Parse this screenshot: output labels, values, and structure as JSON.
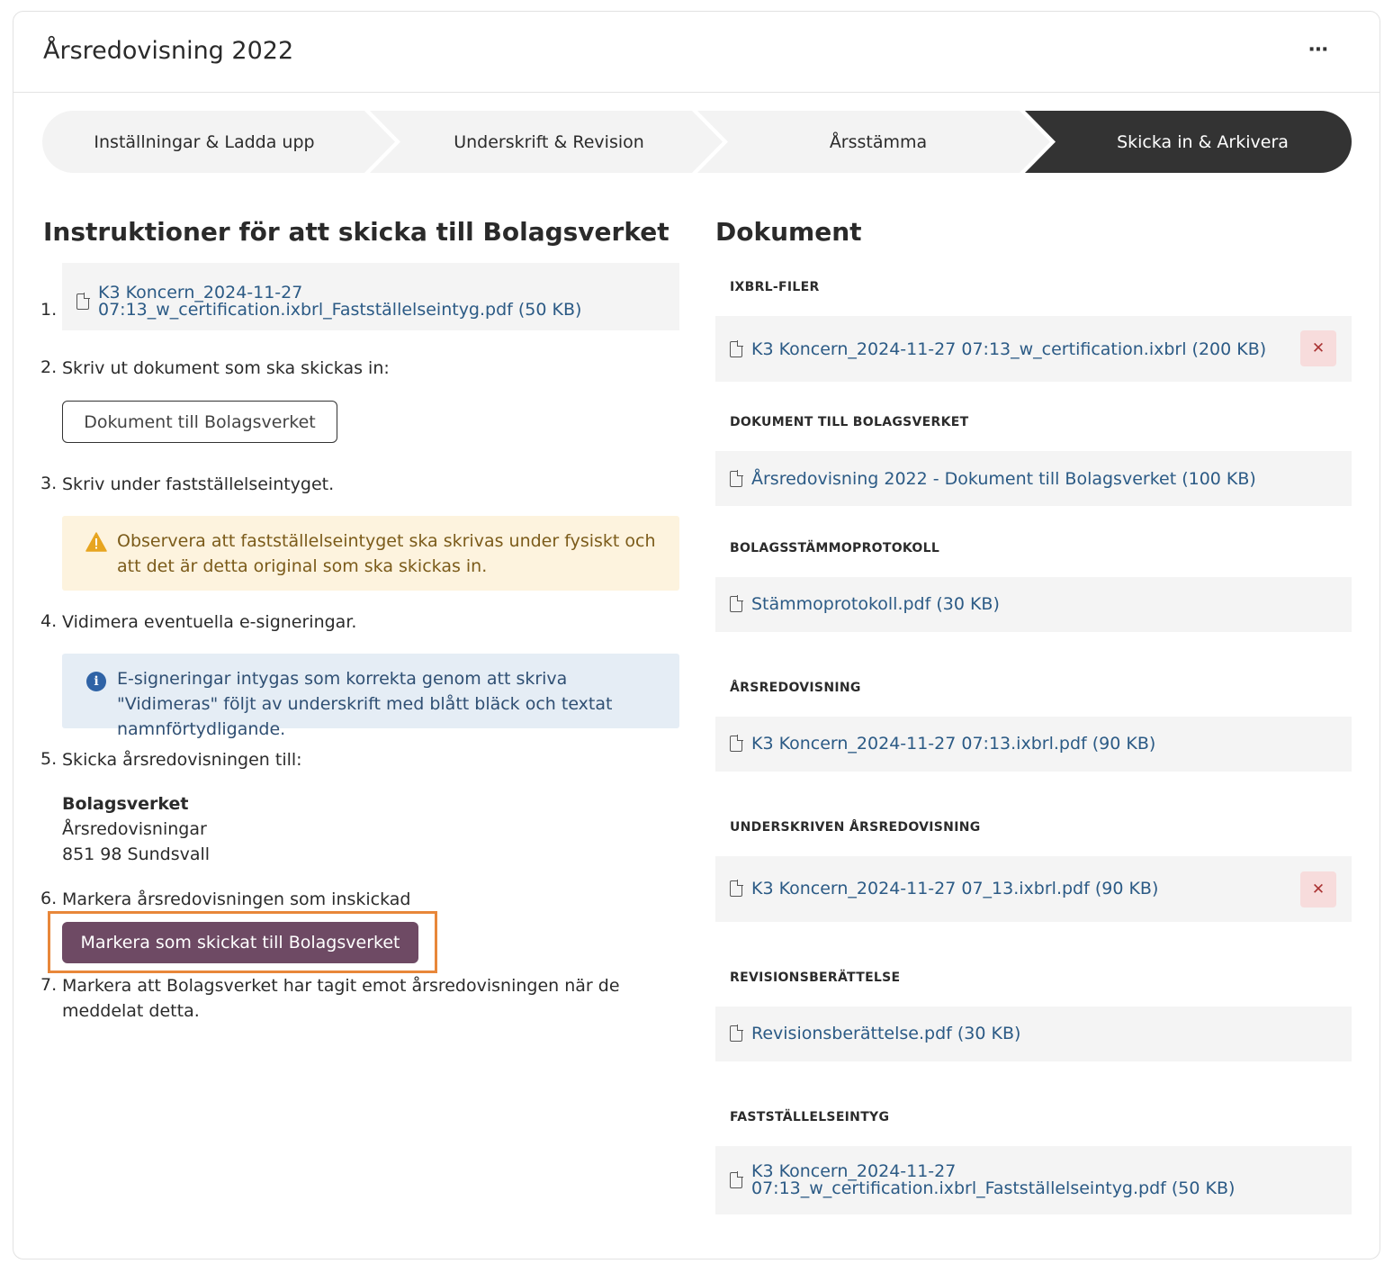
{
  "header": {
    "title": "Årsredovisning 2022",
    "more_label": "⋯"
  },
  "stepper": [
    {
      "label": "Inställningar & Ladda upp",
      "active": false
    },
    {
      "label": "Underskrift & Revision",
      "active": false
    },
    {
      "label": "Årsstämma",
      "active": false
    },
    {
      "label": "Skicka in & Arkivera",
      "active": true
    }
  ],
  "instructions": {
    "title": "Instruktioner för att skicka till Bolagsverket",
    "steps": [
      {
        "num": "1.",
        "file_line1": "K3 Koncern_2024-11-27",
        "file_line2": "07:13_w_certification.ixbrl_Fastställelseintyg.pdf (50 KB)"
      },
      {
        "num": "2.",
        "text": "Skriv ut dokument som ska skickas in:",
        "button": "Dokument till Bolagsverket"
      },
      {
        "num": "3.",
        "text": "Skriv under fastställelseintyget.",
        "warning": "Observera att fastställelseintyget ska skrivas under fysiskt och att det är detta original som ska skickas in."
      },
      {
        "num": "4.",
        "text": "Vidimera eventuella e-signeringar.",
        "info": "E-signeringar intygas som korrekta genom att skriva \"Vidimeras\" följt av underskrift med blått bläck och textat namnförtydligande."
      },
      {
        "num": "5.",
        "text": "Skicka årsredovisningen till:",
        "address": {
          "name": "Bolagsverket",
          "line1": "Årsredovisningar",
          "line2": "851 98 Sundsvall"
        }
      },
      {
        "num": "6.",
        "text": "Markera årsredovisningen som inskickad",
        "button": "Markera som skickat till Bolagsverket"
      },
      {
        "num": "7.",
        "text": "Markera att Bolagsverket har tagit emot årsredovisningen när de meddelat detta."
      }
    ]
  },
  "documents": {
    "title": "Dokument",
    "sections": [
      {
        "label": "IXBRL-FILER",
        "file": "K3 Koncern_2024-11-27 07:13_w_certification.ixbrl (200 KB)",
        "deletable": true
      },
      {
        "label": "DOKUMENT TILL BOLAGSVERKET",
        "file": "Årsredovisning 2022 - Dokument till Bolagsverket (100 KB)",
        "deletable": false
      },
      {
        "label": "BOLAGSSTÄMMOPROTOKOLL",
        "file": "Stämmoprotokoll.pdf (30 KB)",
        "deletable": false
      },
      {
        "label": "ÅRSREDOVISNING",
        "file": "K3 Koncern_2024-11-27 07:13.ixbrl.pdf (90 KB)",
        "deletable": false
      },
      {
        "label": "UNDERSKRIVEN ÅRSREDOVISNING",
        "file": "K3 Koncern_2024-11-27 07_13.ixbrl.pdf (90 KB)",
        "deletable": true
      },
      {
        "label": "REVISIONSBERÄTTELSE",
        "file": "Revisionsberättelse.pdf (30 KB)",
        "deletable": false
      },
      {
        "label": "FASTSTÄLLELSEINTYG",
        "file_line1": "K3 Koncern_2024-11-27",
        "file_line2": "07:13_w_certification.ixbrl_Fastställelseintyg.pdf (50 KB)",
        "deletable": false
      }
    ],
    "delete_label": "✕"
  },
  "colors": {
    "link": "#2b5a85",
    "active_step": "#333333",
    "primary_button": "#6e4a64",
    "highlight": "#e8873a",
    "warning_bg": "#fdf3de",
    "info_bg": "#e5edf5"
  }
}
